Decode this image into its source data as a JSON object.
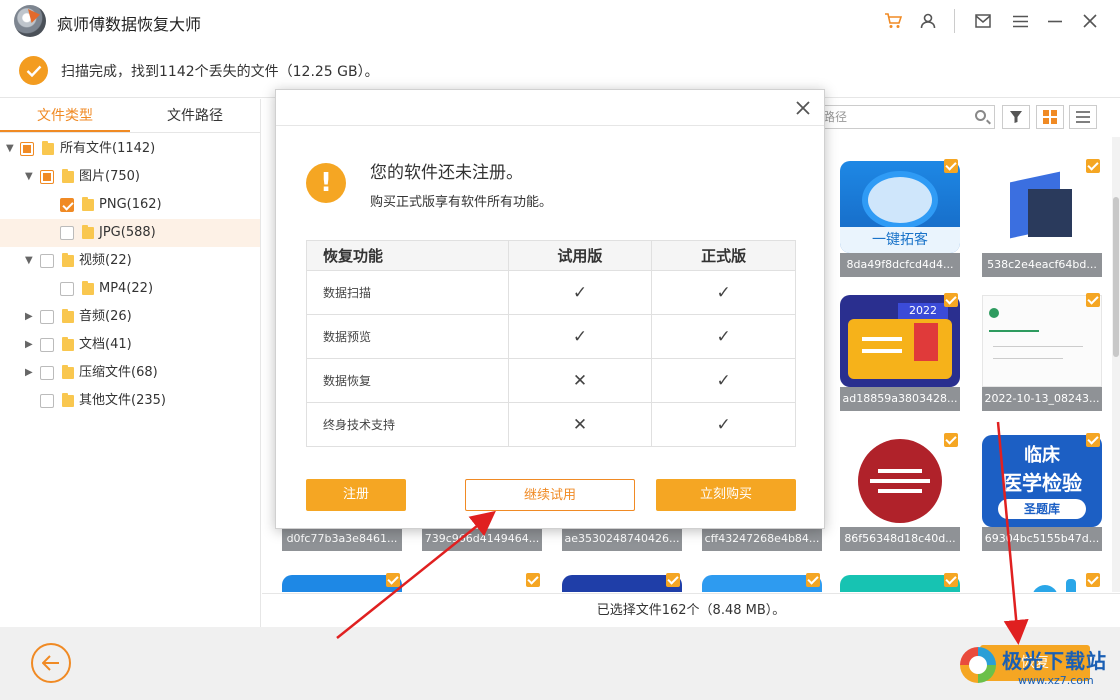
{
  "app": {
    "title": "疯师傅数据恢复大师"
  },
  "titlebar": {
    "icons": [
      "cart-icon",
      "user-icon",
      "mail-icon",
      "menu-icon",
      "minimize-icon",
      "close-icon"
    ]
  },
  "status": {
    "text": "扫描完成，找到1142个丢失的文件（12.25 GB）。"
  },
  "left": {
    "tabs": [
      "文件类型",
      "文件路径"
    ],
    "tree": [
      {
        "label": "所有文件(1142)"
      },
      {
        "label": "图片(750)"
      },
      {
        "label": "PNG(162)"
      },
      {
        "label": "JPG(588)"
      },
      {
        "label": "视频(22)"
      },
      {
        "label": "MP4(22)"
      },
      {
        "label": "音频(26)"
      },
      {
        "label": "文档(41)"
      },
      {
        "label": "压缩文件(68)"
      },
      {
        "label": "其他文件(235)"
      }
    ]
  },
  "toolbar": {
    "search_placeholder": "路径"
  },
  "thumbs": {
    "captions": [
      "8da49f8dcfcd4d4...",
      "538c2e4eacf64bd...",
      "ad18859a3803428...",
      "2022-10-13_08243...",
      "d0fc77b3a3e8461...",
      "739c966d4149464...",
      "ae3530248740426...",
      "cff43247268e4b84...",
      "86f56348d18c40d...",
      "69304bc5155b47d..."
    ],
    "img_texts": {
      "yijian": "一键拓客",
      "year": "2022",
      "linchuang1": "临床",
      "linchuang2": "医学检验",
      "linchuang3": "圣题库"
    }
  },
  "selection": {
    "text": "已选择文件162个（8.48 MB）。"
  },
  "footer": {
    "recover_label": "恢复"
  },
  "watermark": {
    "text": "极光下载站",
    "url": "www.xz7.com"
  },
  "dialog": {
    "title": "您的软件还未注册。",
    "subtitle": "购买正式版享有软件所有功能。",
    "headers": [
      "恢复功能",
      "试用版",
      "正式版"
    ],
    "rows": [
      {
        "feature": "数据扫描",
        "trial": "✓",
        "full": "✓"
      },
      {
        "feature": "数据预览",
        "trial": "✓",
        "full": "✓"
      },
      {
        "feature": "数据恢复",
        "trial": "✕",
        "full": "✓"
      },
      {
        "feature": "终身技术支持",
        "trial": "✕",
        "full": "✓"
      }
    ],
    "buttons": {
      "register": "注册",
      "trial": "继续试用",
      "buy": "立刻购买"
    }
  }
}
